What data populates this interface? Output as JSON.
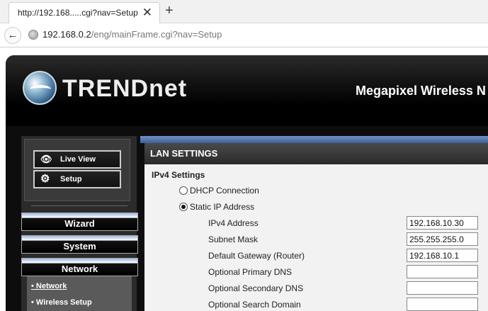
{
  "browser": {
    "tab_title": "http://192.168.....cgi?nav=Setup",
    "close_glyph": "✕",
    "new_tab_glyph": "+",
    "back_glyph": "←",
    "url_host": "192.168.0.2",
    "url_path": "/eng/mainFrame.cgi?nav=Setup"
  },
  "header": {
    "logo_text": "TRENDnet",
    "product_title": "Megapixel Wireless N"
  },
  "left_nav": {
    "live_view": {
      "icon": "eye-icon",
      "glyph": "👁",
      "label": "Live View"
    },
    "setup": {
      "icon": "gear-icon",
      "glyph": "⚙",
      "label": "Setup"
    },
    "menu": {
      "wizard": "Wizard",
      "system": "System",
      "network": "Network"
    },
    "network_sub": {
      "network": "• Network",
      "wireless": "• Wireless Setup"
    }
  },
  "lan": {
    "section_title": "LAN SETTINGS",
    "ipv4_heading": "IPv4 Settings",
    "dhcp_label": "DHCP Connection",
    "static_label": "Static IP Address",
    "selected_mode": "static",
    "fields": [
      {
        "label": "IPv4 Address",
        "value": "192.168.10.30"
      },
      {
        "label": "Subnet Mask",
        "value": "255.255.255.0"
      },
      {
        "label": "Default Gateway (Router)",
        "value": "192.168.10.1"
      },
      {
        "label": "Optional Primary DNS",
        "value": ""
      },
      {
        "label": "Optional Secondary DNS",
        "value": ""
      },
      {
        "label": "Optional Search Domain",
        "value": ""
      }
    ]
  }
}
